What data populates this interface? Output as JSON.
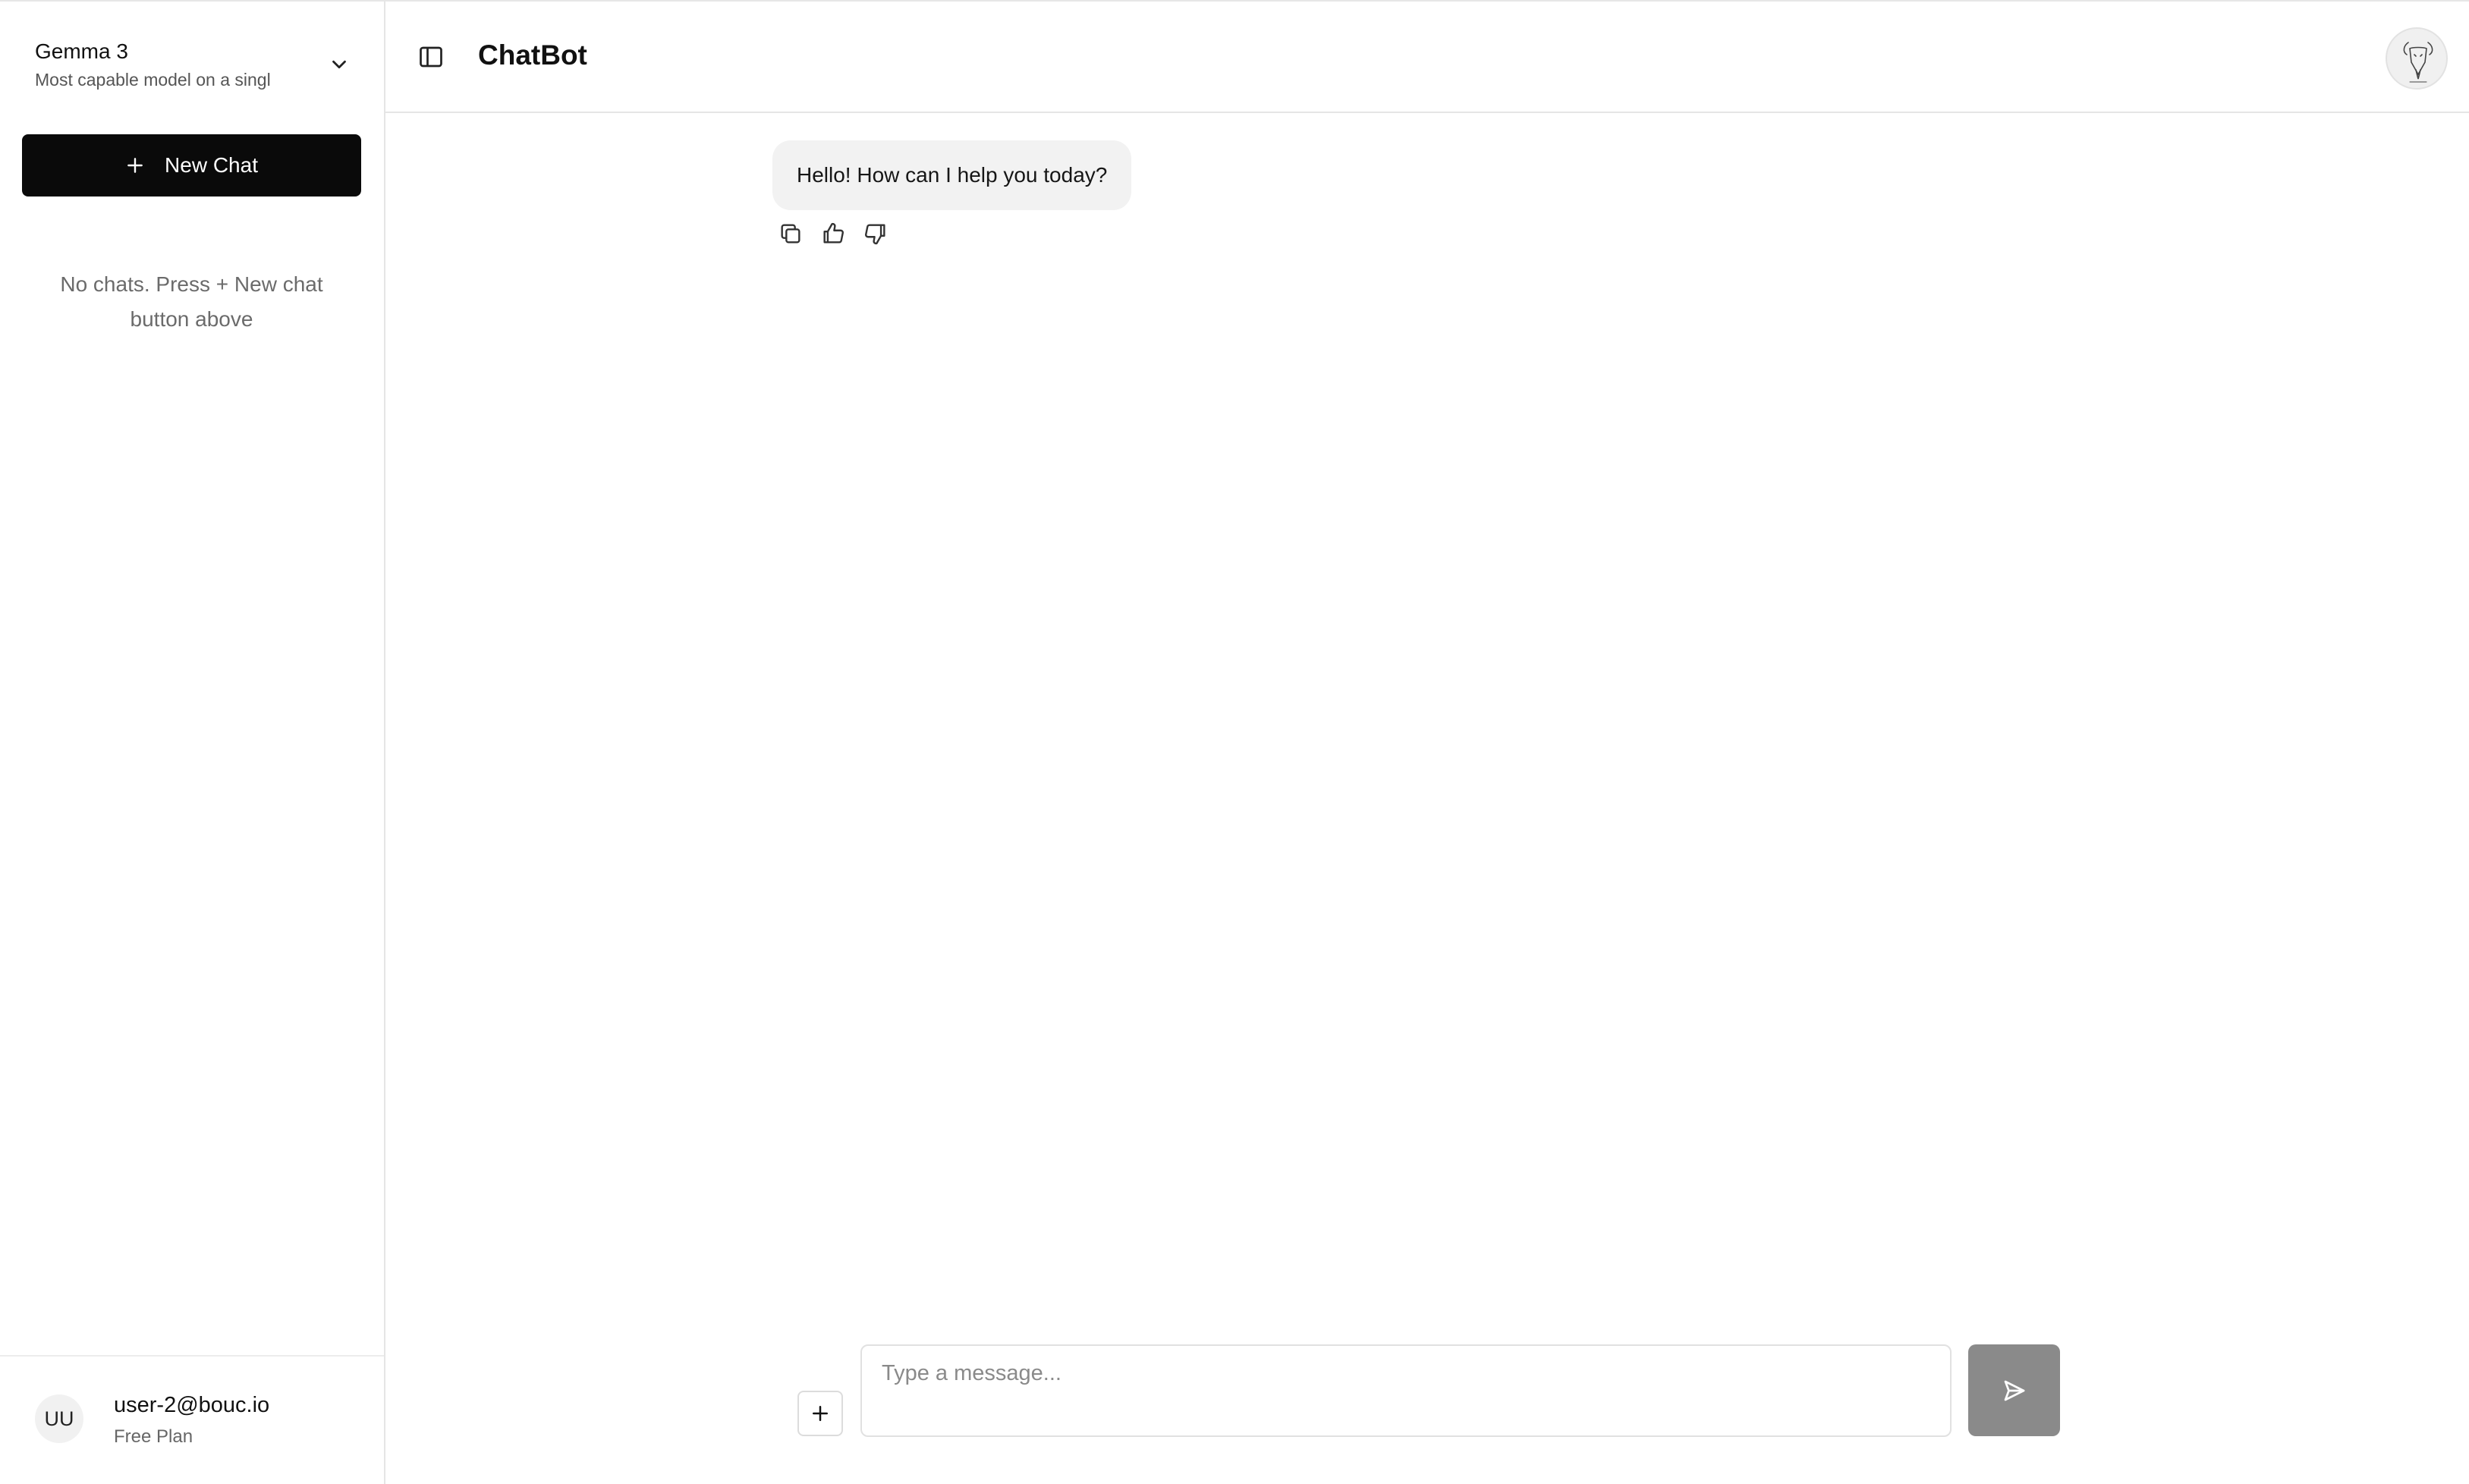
{
  "sidebar": {
    "model": {
      "name": "Gemma 3",
      "description": "Most capable model on a singl",
      "chevron_icon": "chevron-down-icon"
    },
    "new_chat": {
      "label": "New Chat",
      "icon": "plus-icon"
    },
    "empty_state": "No chats. Press + New chat button above",
    "user": {
      "initials": "UU",
      "email": "user-2@bouc.io",
      "plan": "Free Plan"
    }
  },
  "header": {
    "title": "ChatBot",
    "toggle_icon": "sidebar-toggle-icon",
    "avatar_icon": "bot-logo-avatar"
  },
  "messages": [
    {
      "role": "assistant",
      "text": "Hello! How can I help you today?",
      "actions": [
        "copy-icon",
        "thumbs-up-icon",
        "thumbs-down-icon"
      ]
    }
  ],
  "composer": {
    "placeholder": "Type a message...",
    "value": "",
    "attach_icon": "plus-icon",
    "send_icon": "send-icon"
  },
  "colors": {
    "primary_button": "#0a0a0a",
    "send_button_disabled": "#8a8a8a",
    "bubble_bg": "#f2f2f2",
    "border": "#e5e5e5"
  }
}
